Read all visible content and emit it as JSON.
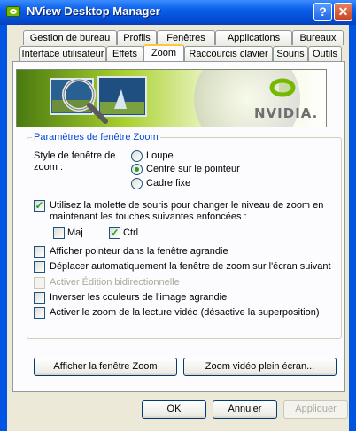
{
  "window": {
    "title": "NView Desktop Manager",
    "help_glyph": "?",
    "close_glyph": "✕"
  },
  "tabs_row1": [
    "Gestion de bureau",
    "Profils",
    "Fenêtres",
    "Applications",
    "Bureaux"
  ],
  "tabs_row2": [
    "Interface utilisateur",
    "Effets",
    "Zoom",
    "Raccourcis clavier",
    "Souris",
    "Outils"
  ],
  "active_tab": "Zoom",
  "banner": {
    "brand": "NVIDIA.",
    "accent": "#76b900"
  },
  "group": {
    "title": "Paramètres de fenêtre Zoom"
  },
  "zoom_style": {
    "label": "Style de fenêtre de zoom :",
    "options": [
      "Loupe",
      "Centré sur le pointeur",
      "Cadre fixe"
    ],
    "selected": "Centré sur le pointeur"
  },
  "wheel_option": {
    "label": "Utilisez la molette de souris pour changer le niveau de zoom en maintenant les touches suivantes enfoncées :",
    "checked": true
  },
  "keys": {
    "maj": "Maj",
    "maj_checked": false,
    "ctrl": "Ctrl",
    "ctrl_checked": true
  },
  "options": [
    {
      "label": "Afficher pointeur dans la fenêtre agrandie",
      "checked": false,
      "enabled": true
    },
    {
      "label": "Déplacer automatiquement la fenêtre de zoom sur l'écran suivant",
      "checked": false,
      "enabled": true
    },
    {
      "label": "Activer Édition bidirectionnelle",
      "checked": false,
      "enabled": false
    },
    {
      "label": "Inverser les couleurs de l'image agrandie",
      "checked": false,
      "enabled": true
    },
    {
      "label": "Activer le zoom de la lecture vidéo (désactive la superposition)",
      "checked": false,
      "enabled": true
    }
  ],
  "actions": {
    "show_zoom": "Afficher la fenêtre Zoom",
    "fullscreen_video": "Zoom vidéo plein écran..."
  },
  "footer": {
    "ok": "OK",
    "cancel": "Annuler",
    "apply": "Appliquer"
  }
}
